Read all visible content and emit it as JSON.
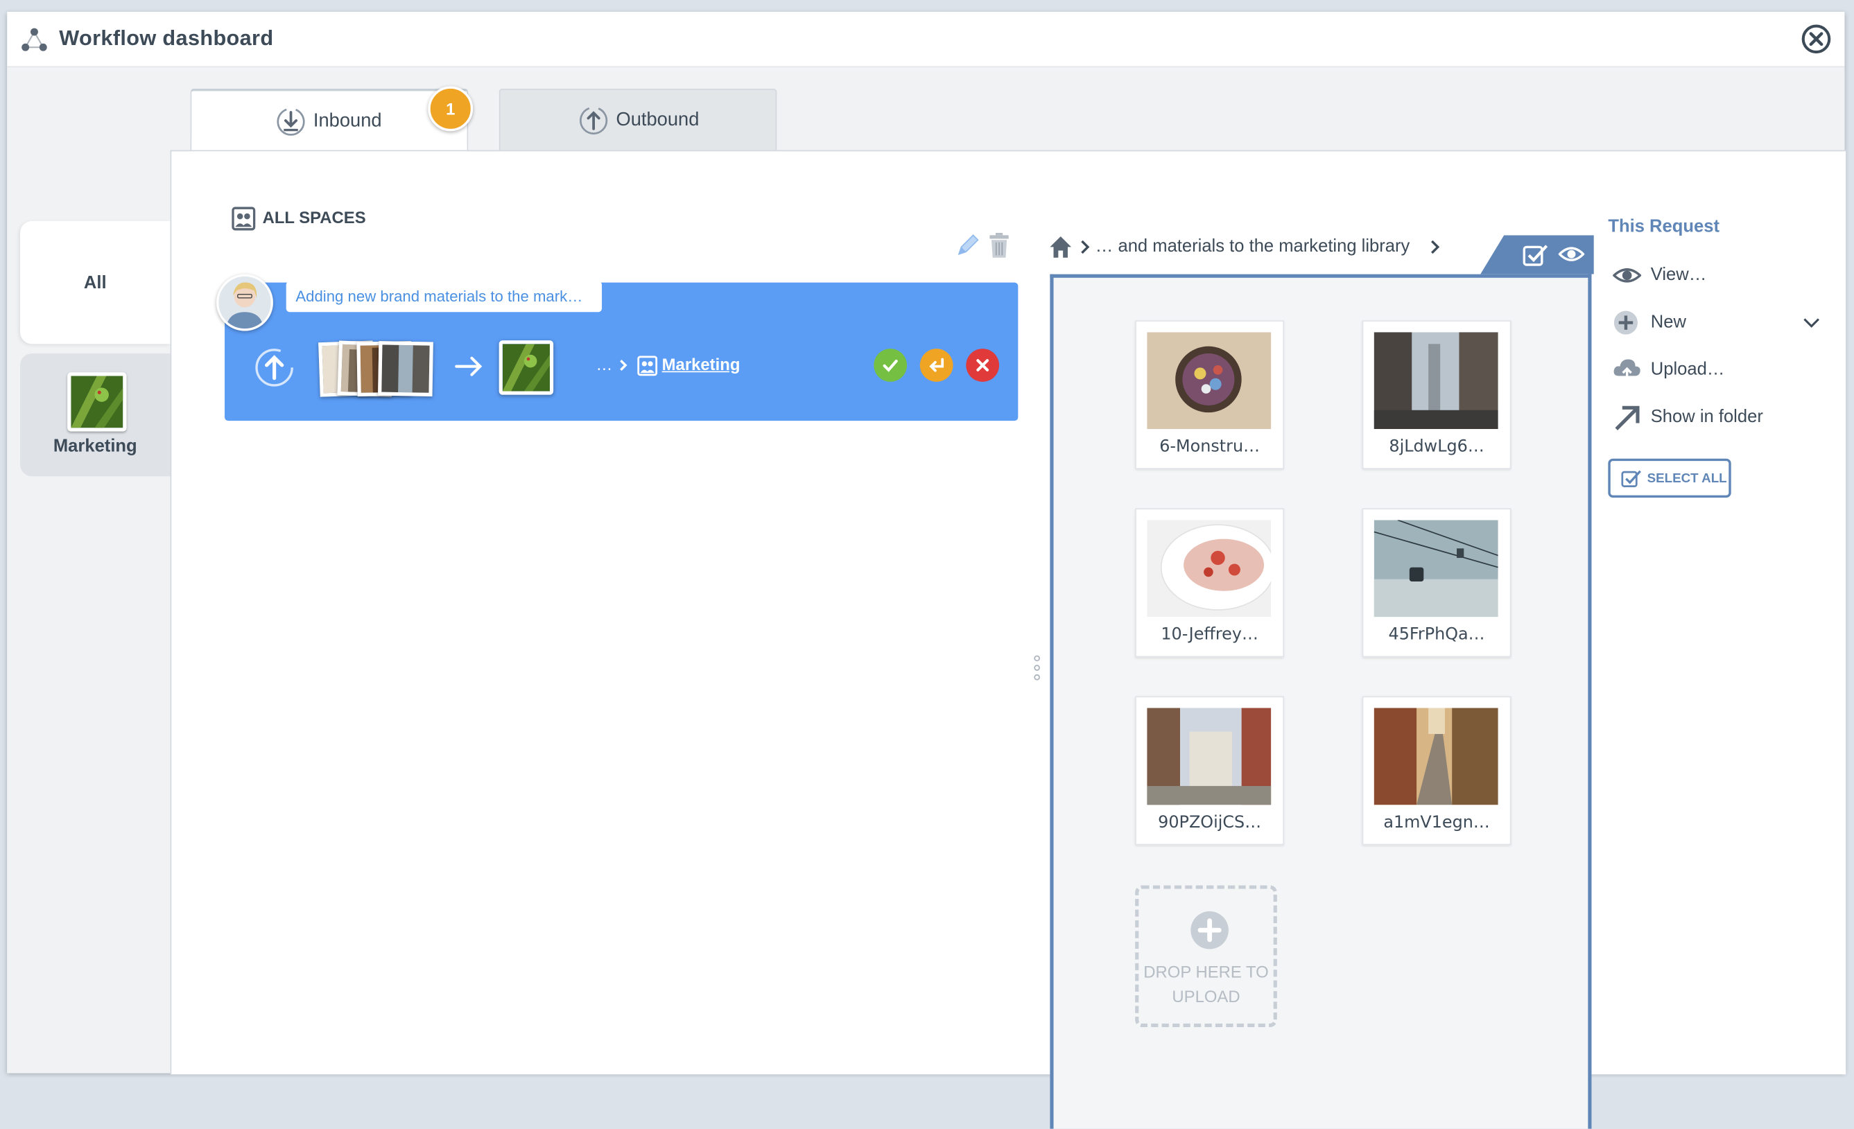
{
  "window": {
    "title": "Workflow dashboard"
  },
  "tabs": [
    {
      "label": "Inbound",
      "badge": "1",
      "active": true
    },
    {
      "label": "Outbound",
      "active": false
    }
  ],
  "sidebar": {
    "items": [
      {
        "label": "All",
        "active": true
      },
      {
        "label": "Marketing",
        "active": false
      }
    ]
  },
  "spaces": {
    "heading": "ALL SPACES"
  },
  "request": {
    "message": "Adding new brand materials to the mark…",
    "destination_prefix": "…",
    "destination": "Marketing"
  },
  "breadcrumb": {
    "path": "… and materials to the marketing library"
  },
  "files": [
    {
      "name": "6-Monstru…"
    },
    {
      "name": "8jLdwLg6…"
    },
    {
      "name": "10-Jeffrey…"
    },
    {
      "name": "45FrPhQa…"
    },
    {
      "name": "90PZOijCS…"
    },
    {
      "name": "a1mV1egn…"
    }
  ],
  "dropzone": {
    "label": "DROP HERE TO UPLOAD"
  },
  "right_panel": {
    "title": "This Request",
    "actions": [
      {
        "label": "View…",
        "icon": "eye-icon"
      },
      {
        "label": "New",
        "icon": "plus-icon"
      },
      {
        "label": "Upload…",
        "icon": "cloud-upload-icon"
      },
      {
        "label": "Show in folder",
        "icon": "arrow-up-right-icon"
      }
    ],
    "select_all": "SELECT ALL"
  },
  "colors": {
    "accent_blue": "#5b9cf5",
    "frame_blue": "#5f86b7",
    "approve_green": "#75c043",
    "return_orange": "#f0a424",
    "reject_red": "#e03a3a"
  }
}
